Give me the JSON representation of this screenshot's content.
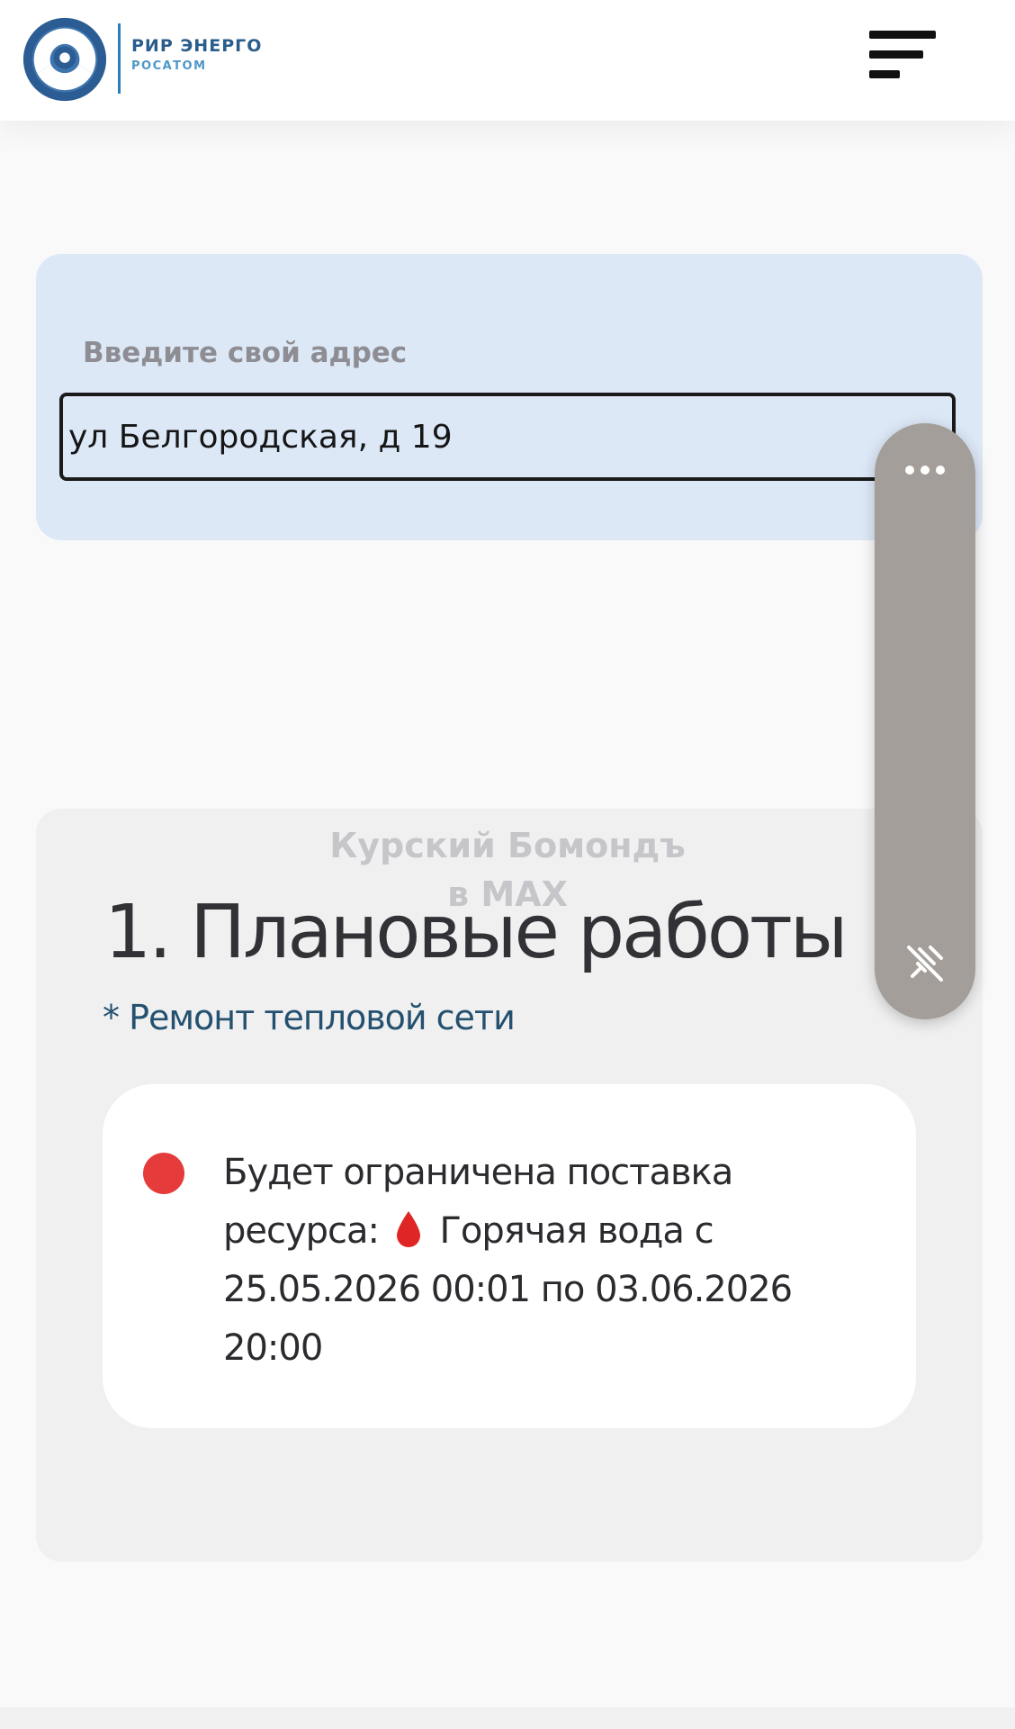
{
  "header": {
    "logo_line1": "РИР ЭНЕРГО",
    "logo_line2": "РОСАТОМ",
    "logo_icon": "rosatom-logo-icon",
    "menu_icon": "menu-icon",
    "brand_color": "#2a5c8c"
  },
  "address": {
    "label": "Введите свой адрес",
    "value": "ул Белгородская, д 19"
  },
  "outage": {
    "title": "1. Плановые работы",
    "subtitle": "* Ремонт тепловой сети",
    "notice": {
      "status_color": "#e53b3b",
      "text_before_icon": "Будет ограничена поставка ресурса:",
      "resource_icon": "water-drop-icon",
      "text_after_icon": "Горячая вода с 25.05.2026 00:01 по 03.06.2026 20:00"
    }
  },
  "watermark": {
    "line1": "Курский Бомондъ",
    "line2": "в MAX"
  },
  "floating_panel": {
    "more_icon": "more-dots-icon",
    "unpin_icon": "unpin-icon"
  }
}
